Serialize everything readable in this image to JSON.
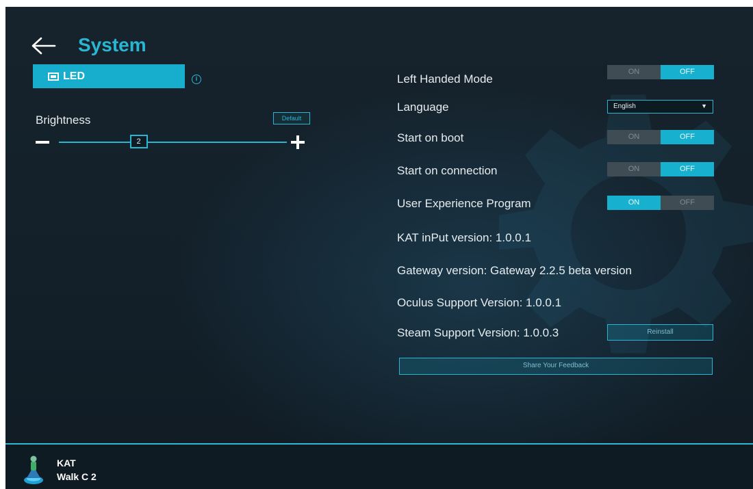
{
  "header": {
    "title": "System"
  },
  "left_panel": {
    "led_tab_label": "LED",
    "brightness_label": "Brightness",
    "default_button_label": "Default",
    "brightness_value": "2",
    "brightness_level": 2,
    "brightness_max": 10
  },
  "settings": {
    "left_handed": {
      "label": "Left Handed Mode",
      "on_label": "ON",
      "off_label": "OFF",
      "state": "OFF"
    },
    "language": {
      "label": "Language",
      "value": "English"
    },
    "start_on_boot": {
      "label": "Start on boot",
      "on_label": "ON",
      "off_label": "OFF",
      "state": "OFF"
    },
    "start_on_connection": {
      "label": "Start on connection",
      "on_label": "ON",
      "off_label": "OFF",
      "state": "OFF"
    },
    "user_experience": {
      "label": "User Experience Program",
      "on_label": "ON",
      "off_label": "OFF",
      "state": "ON"
    }
  },
  "versions": {
    "kat_input": "KAT inPut version: 1.0.0.1",
    "gateway": "Gateway version: Gateway 2.2.5 beta version",
    "oculus": "Oculus Support Version: 1.0.0.1",
    "steam": "Steam Support Version: 1.0.0.3",
    "reinstall_label": "Reinstall"
  },
  "feedback_button_label": "Share Your Feedback",
  "footer": {
    "device_line1": "KAT",
    "device_line2": "Walk C 2"
  },
  "colors": {
    "accent": "#17aece",
    "background": "#13202a",
    "toggle_off": "#3f4c54"
  }
}
